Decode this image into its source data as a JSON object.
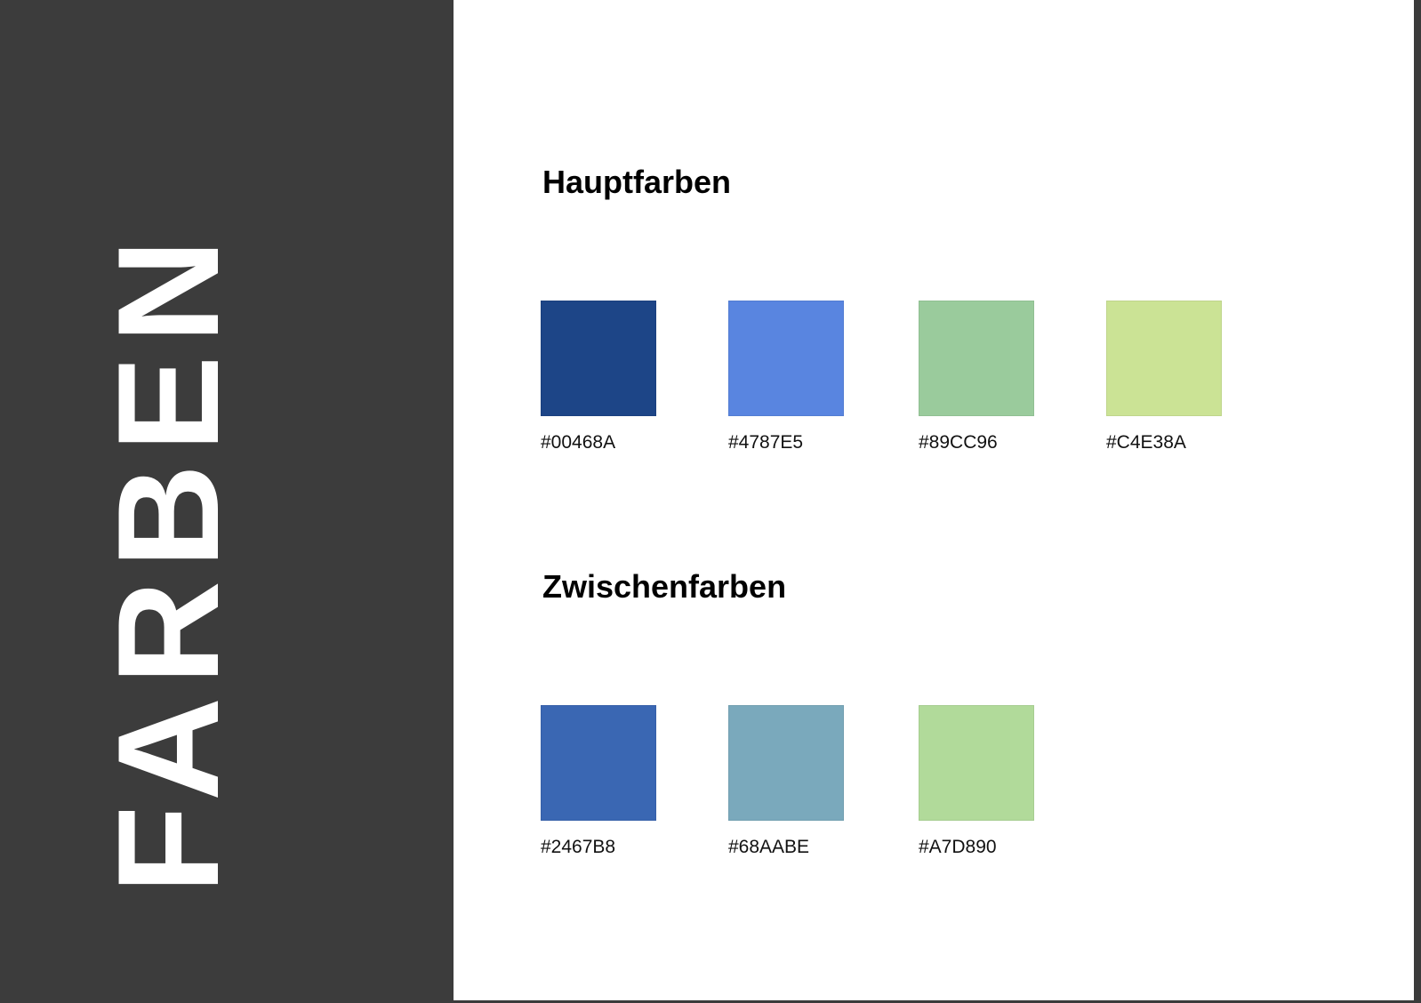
{
  "sidebar": {
    "title": "FARBEN"
  },
  "main_colors": {
    "title": "Hauptfarben",
    "swatches": [
      {
        "label": "#00468A",
        "color": "#1D4587"
      },
      {
        "label": "#4787E5",
        "color": "#5985E0"
      },
      {
        "label": "#89CC96",
        "color": "#9ACB9C"
      },
      {
        "label": "#C4E38A",
        "color": "#CBE395"
      }
    ]
  },
  "intermediate_colors": {
    "title": "Zwischenfarben",
    "swatches": [
      {
        "label": "#2467B8",
        "color": "#3A67B3"
      },
      {
        "label": "#68AABE",
        "color": "#7AA9BC"
      },
      {
        "label": "#A7D890",
        "color": "#B1DA9A"
      }
    ]
  },
  "theme": {
    "sidebar_background": "#3C3C3C",
    "content_background": "#FFFFFF",
    "title_text": "#FFFFFF"
  }
}
